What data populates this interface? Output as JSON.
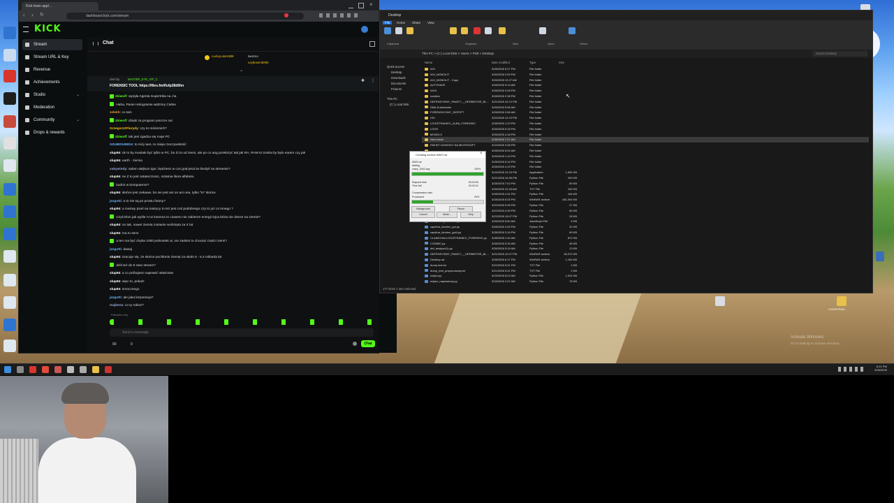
{
  "browser": {
    "tab_title": "Kick team app/...",
    "url": "dashboard.kick.com/stream"
  },
  "kick": {
    "logo": "KICK",
    "nav": [
      {
        "label": "Stream",
        "icon": "stream-icon",
        "active": true
      },
      {
        "label": "Stream URL & Key",
        "icon": "key-icon"
      },
      {
        "label": "Revenue",
        "icon": "revenue-icon"
      },
      {
        "label": "Achievements",
        "icon": "trophy-icon"
      },
      {
        "label": "Studio",
        "icon": "studio-icon"
      },
      {
        "label": "Moderation",
        "icon": "shield-icon"
      },
      {
        "label": "Community",
        "icon": "community-icon"
      },
      {
        "label": "Drops & rewards",
        "icon": "gift-icon"
      }
    ],
    "chat": {
      "title": "Chat",
      "top_user_1": "LuckyLuke1989",
      "top_user_2": "twormo",
      "top_user_3": "uzytkownik090",
      "pinned_by": "Sent by",
      "pinned_user": "MASTER_EYE_VIP_C",
      "pinned_text": "FORENSIC TOOL https://files.fm/f/ufp28d6hn",
      "messages": [
        {
          "user": "zbiwolf",
          "text": "wysyła Agenta Supertrika na..ha"
        },
        {
          "user": "",
          "text": "Haha, Panie Hologramie widzimy Ciebie"
        },
        {
          "user": "zelekh",
          "text": "co tam"
        },
        {
          "user": "zbiwolf",
          "text": "dzięki za program jeszcze raz"
        },
        {
          "user": "Grzegorz2Florydy",
          "text": "czy to mózemich?"
        },
        {
          "user": "zbiwolf",
          "text": "tak jest zgadza się moje PC"
        },
        {
          "user": "SZUBIDUBIDU",
          "text": "to mój nam, to mieja rzeczywistość"
        },
        {
          "user": "slup94",
          "text": "ok to by musiało być tylko w PC, bo Zi to od ziemi, ale po co ang przełożyć tak jak RA, RAM to trzeba by było earam czy jak"
        },
        {
          "user": "slup94",
          "text": "earth - ziemia"
        },
        {
          "user": "xakywindy",
          "text": "salam alejkum igor, będziesz w cos grał jeszcze kiedyś na streamie?"
        },
        {
          "user": "slup94",
          "text": "ne Z to jest ostatecznosc, ostatnia litera alfabetu"
        },
        {
          "user": "",
          "text": "kudrio w komputerze?"
        },
        {
          "user": "slup94",
          "text": "słońce jest ciekawe, bo nie jest ani on ani ona, tylko \"to\" słońce"
        },
        {
          "user": "jezgotti",
          "text": "a to nie są po prostu fotony?"
        },
        {
          "user": "slup94",
          "text": "a martwy pixel na matrycy to też jest coś podobnego czy to już co innego ?"
        },
        {
          "user": "",
          "text": "Czyli Elon jak wyśle AI w kosmos to czasem nie zabierze energii Ojca która nie dotrze na ziemie?"
        },
        {
          "user": "slup94",
          "text": "no tak, nawet ziemia zostanie wciśnięta za X lat"
        },
        {
          "user": "slup94",
          "text": "ma to sens"
        },
        {
          "user": "",
          "text": "a ten ma być chyba 1000 jednostek ai, nie zasłoni to chociaż części ziemi?"
        },
        {
          "user": "jezgotti",
          "text": "dawaj"
        },
        {
          "user": "slup94",
          "text": "szacuje się, że słońce pochłonie ziemię za około 5 - 5,4 miliarda lat"
        },
        {
          "user": "",
          "text": "dziś też do 6 rano stream?"
        },
        {
          "user": "slup94",
          "text": "a co próbujesz naprawić właściwie"
        },
        {
          "user": "slup94",
          "text": "więc to, pokaż!"
        },
        {
          "user": "slup94",
          "text": "smacznego"
        },
        {
          "user": "jezgotti",
          "text": "ale jaka korporacja?"
        },
        {
          "user": "majkena",
          "text": "co ty robisz?"
        }
      ],
      "followers_only": "Followers only",
      "input_placeholder": "Send a message",
      "count_left": "00",
      "count_right": "0",
      "send_label": "Chat"
    }
  },
  "explorer": {
    "title": "Desktop",
    "ribbon_tabs": [
      "File",
      "Home",
      "Share",
      "View"
    ],
    "ribbon_groups": [
      "Clipboard",
      "Organize",
      "New",
      "Open",
      "Select"
    ],
    "ribbon_buttons": [
      "Pin to Quick access",
      "Copy",
      "Paste",
      "Cut",
      "Copy path",
      "Paste shortcut",
      "Move to",
      "Copy to",
      "Delete",
      "Rename",
      "New folder",
      "New item",
      "Easy access",
      "Properties",
      "Open",
      "Edit",
      "History",
      "Select all",
      "Select none",
      "Invert selection"
    ],
    "path": "This PC  >  (C:) Local Disk  >  Users  >  Piotl  >  Desktop",
    "search_placeholder": "Search Desktop",
    "nav": [
      "Quick access",
      "Desktop",
      "Downloads",
      "Documents",
      "Pictures",
      "This PC",
      "(C:) Local Disk"
    ],
    "columns": [
      "Name",
      "Date modified",
      "Type",
      "Size"
    ],
    "files": [
      {
        "name": "AGI",
        "date": "3/28/2026 5:27 PM",
        "type": "File folder",
        "size": ""
      },
      {
        "name": "AGI_MONOLIT",
        "date": "3/26/2026 2:59 PM",
        "type": "File folder",
        "size": ""
      },
      {
        "name": "AGI_MONOLIT - Copy",
        "date": "3/26/2026 12:27 AM",
        "type": "File folder",
        "size": ""
      },
      {
        "name": "AUTOSAVE",
        "date": "3/28/2026 3:14 AM",
        "type": "File folder",
        "size": ""
      },
      {
        "name": "AXIS",
        "date": "3/28/2026 3:28 PM",
        "type": "File folder",
        "size": ""
      },
      {
        "name": "cookies",
        "date": "3/28/2026 2:38 PM",
        "type": "File folder",
        "size": ""
      },
      {
        "name": "DEFENSYWNY_PAKIET_-_HERBWTOR_BL...",
        "date": "3/21/2026 10:12 PM",
        "type": "File folder",
        "size": ""
      },
      {
        "name": "DNA-Kustomator",
        "date": "3/26/2026 5:55 AM",
        "type": "File folder",
        "size": ""
      },
      {
        "name": "FORENSICOWY_SKRYPT",
        "date": "3/28/2026 3:56 AM",
        "type": "File folder",
        "size": ""
      },
      {
        "name": "HVI",
        "date": "3/22/2026 12:10 PM",
        "type": "File folder",
        "size": ""
      },
      {
        "name": "LOGISTRANIEC_ALBA_FORENSIC",
        "date": "3/28/2026 1:23 PM",
        "type": "File folder",
        "size": ""
      },
      {
        "name": "LOGS",
        "date": "3/26/2026 5:16 PM",
        "type": "File folder",
        "size": ""
      },
      {
        "name": "MODELS",
        "date": "3/25/2026 4:18 PM",
        "type": "File folder",
        "size": ""
      },
      {
        "name": "New folder",
        "date": "3/28/2026 7:07 AM",
        "type": "File folder",
        "size": ""
      },
      {
        "name": "PAKIET DOWODY NA MICROSOFT",
        "date": "3/22/2026 3:38 PM",
        "type": "File folder",
        "size": ""
      },
      {
        "name": "",
        "date": "3/28/2026 5:04 AM",
        "type": "File folder",
        "size": ""
      },
      {
        "name": "",
        "date": "3/25/2026 1:14 PM",
        "type": "File folder",
        "size": ""
      },
      {
        "name": "",
        "date": "3/28/2026 5:16 PM",
        "type": "File folder",
        "size": ""
      },
      {
        "name": "",
        "date": "3/28/2026 4:19 PM",
        "type": "File folder",
        "size": ""
      },
      {
        "name": "",
        "date": "3/24/2026 12:15 PM",
        "type": "Application",
        "size": "1,552 KB"
      },
      {
        "name": "",
        "date": "3/21/2026 10:36 PM",
        "type": "Python File",
        "size": "209 KB"
      },
      {
        "name": "",
        "date": "3/28/2026 7:02 PM",
        "type": "Python File",
        "size": "69 KB"
      },
      {
        "name": "",
        "date": "3/26/2026 12:33 AM",
        "type": "TXT File",
        "size": "245 KB"
      },
      {
        "name": "",
        "date": "3/28/2026 4:31 PM",
        "type": "Python File",
        "size": "164 KB"
      },
      {
        "name": "",
        "date": "3/28/2026 6:25 PM",
        "type": "WinRAR archive",
        "size": "481,094 KB"
      },
      {
        "name": "",
        "date": "3/22/2026 5:36 PM",
        "type": "Python File",
        "size": "27 KB"
      },
      {
        "name": "",
        "date": "3/22/2026 4:39 PM",
        "type": "Python File",
        "size": "65 KB"
      },
      {
        "name": "",
        "date": "3/22/2026 10:07 PM",
        "type": "Python File",
        "size": "28 KB"
      },
      {
        "name": "CAPTCHA_BRUTAL.py",
        "date": "3/26/2026 5:50 AM",
        "type": "JavaScript File",
        "size": "5 KB"
      },
      {
        "name": "captcha_blocker_gui.py",
        "date": "3/28/2026 2:45 PM",
        "type": "Python File",
        "size": "32 KB"
      },
      {
        "name": "captcha_blocker_gui4.py",
        "date": "3/28/2026 3:16 PM",
        "type": "Python File",
        "size": "69 KB"
      },
      {
        "name": "CLAIMCHALLOGISTRANIEC_FORENSIC.py",
        "date": "3/28/2026 1:40 AM",
        "type": "Python File",
        "size": "872 KB"
      },
      {
        "name": "COSMIC.py",
        "date": "3/28/2026 5:16 AM",
        "type": "Python File",
        "size": "46 KB"
      },
      {
        "name": "def_analyze(1).py",
        "date": "3/26/2026 5:15 AM",
        "type": "Python File",
        "size": "13 KB"
      },
      {
        "name": "DEFENSYWNY_PAKIET_-_HERBWTOR_BL...",
        "date": "3/21/2026 10:37 PM",
        "type": "WinRAR archive",
        "size": "45,972 KB"
      },
      {
        "name": "Desktop.rar",
        "date": "3/28/2026 6:17 PM",
        "type": "WinRAR archive",
        "size": "1,164 KB"
      },
      {
        "name": "dump test.txt",
        "date": "3/22/2026 5:31 PM",
        "type": "TXT File",
        "size": "4 KB"
      },
      {
        "name": "dump_test_proponowany.txt",
        "date": "3/21/2026 9:21 PM",
        "type": "TXT File",
        "size": "2 KB"
      },
      {
        "name": "edytor.py",
        "date": "3/23/2026 8:22 AM",
        "type": "Python File",
        "size": "1,024 KB"
      },
      {
        "name": "edytor_naprawiony.py",
        "date": "3/23/2026 2:07 AM",
        "type": "Python File",
        "size": "78 KB"
      }
    ],
    "selected_index": 13,
    "status": "177 items   1 item selected"
  },
  "dialog": {
    "title": "Creating archive AWO.rar",
    "line1": "AWO.rar",
    "line2": "adding",
    "line3": "crazy_2942.avg",
    "pct1": "100%",
    "elapsed_label": "Elapsed time",
    "elapsed_value": "00:03:55",
    "left_label": "Time left",
    "left_value": "00:02:01",
    "ratio_label": "Compression ratio",
    "processed_label": "Processed",
    "processed_value": "29%",
    "progress_top": 1.0,
    "progress_bottom": 0.29,
    "buttons": [
      "Background",
      "Pause",
      "Cancel",
      "Mode...",
      "Help"
    ]
  },
  "desktop": {
    "watermark_line1": "Activate Windows",
    "watermark_line2": "Go to Settings to activate Windows.",
    "icon_right_1": "",
    "icon_right_2": "LOGISTRAN..."
  },
  "taskbar": {
    "time": "6:21 PM",
    "date": "3/28/2026"
  }
}
